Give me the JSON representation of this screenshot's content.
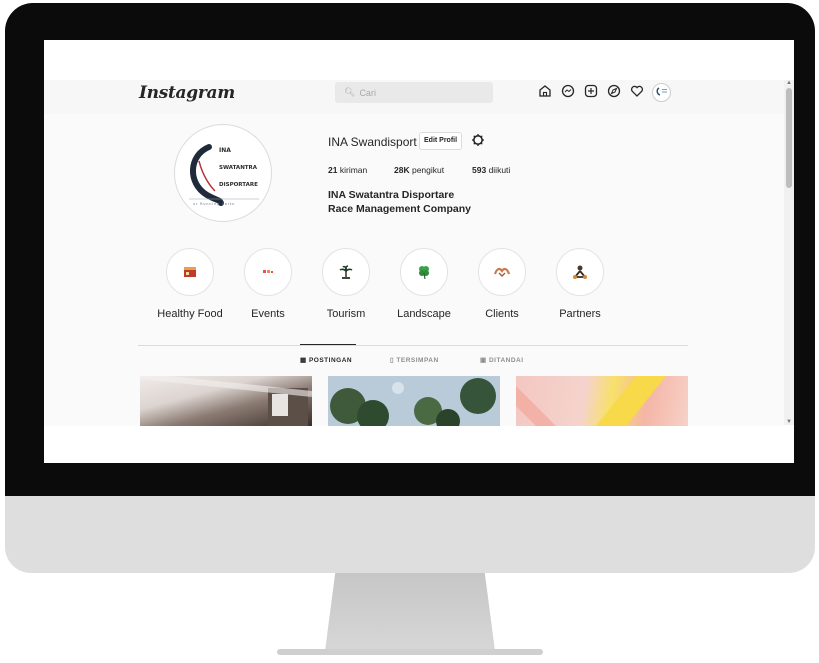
{
  "app": {
    "logo": "Instagram"
  },
  "search": {
    "icon": "search-icon",
    "placeholder": "Cari"
  },
  "nav": {
    "icons": [
      "home-icon",
      "messenger-icon",
      "new-post-icon",
      "explore-icon",
      "heart-icon",
      "profile-avatar"
    ]
  },
  "profile": {
    "avatar_text": {
      "line1": "INA",
      "line2": "SWATANTRA",
      "line3": "DISPORTARE",
      "tagline": "ur Running Partn"
    },
    "username": "INA Swandisport",
    "edit_button": "Edit Profil",
    "stats": {
      "posts_value": "21",
      "posts_label": "kiriman",
      "followers_value": "28K",
      "followers_label": "pengikut",
      "following_value": "593",
      "following_label": "diikuti"
    },
    "full_name_line1": "INA Swatantra Disportare",
    "full_name_line2": "Race Management Company"
  },
  "highlights": [
    {
      "label": "Healthy Food",
      "icon": "food-icon"
    },
    {
      "label": "Events",
      "icon": "events-icon"
    },
    {
      "label": "Tourism",
      "icon": "palm-tree-icon"
    },
    {
      "label": "Landscape",
      "icon": "clover-icon"
    },
    {
      "label": "Clients",
      "icon": "handshake-icon"
    },
    {
      "label": "Partners",
      "icon": "partners-icon"
    }
  ],
  "tabs": {
    "posts": "POSTINGAN",
    "saved": "TERSIMPAN",
    "tagged": "DITANDAI"
  },
  "colors": {
    "accent": "#262626",
    "muted": "#8e8e8e",
    "background": "#fafafa"
  }
}
